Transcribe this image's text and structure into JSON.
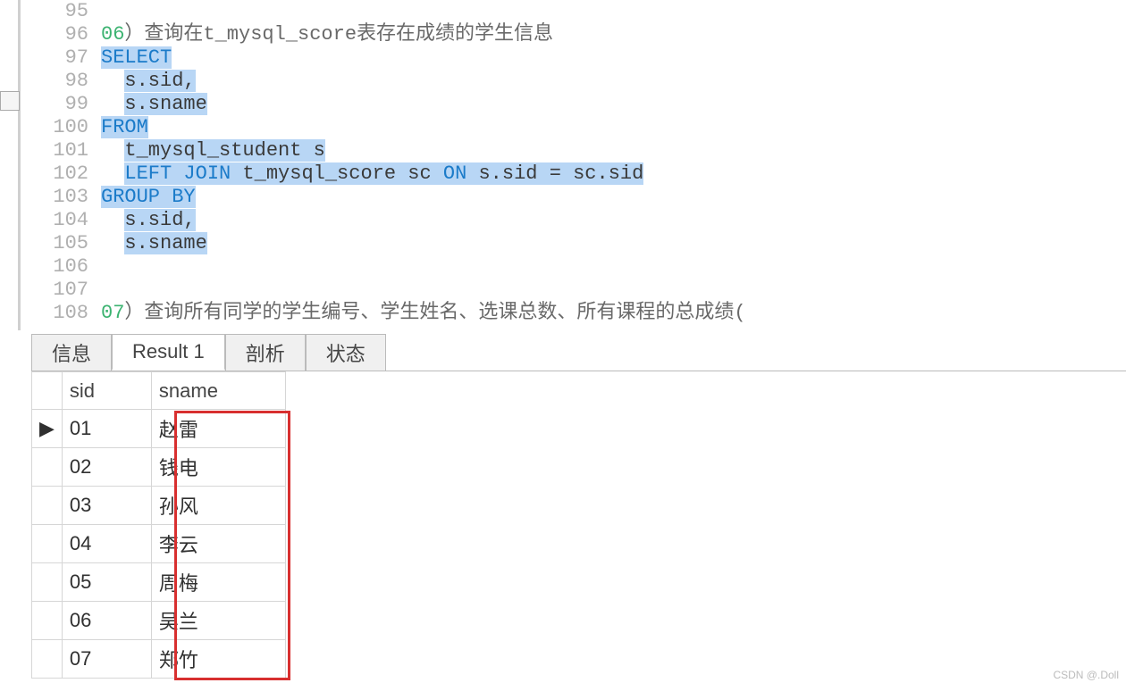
{
  "editor": {
    "line_numbers": [
      "95",
      "96",
      "97",
      "98",
      "99",
      "100",
      "101",
      "102",
      "103",
      "104",
      "105",
      "106",
      "107",
      "108"
    ],
    "lines": {
      "l95": "",
      "l96_pre": "06）查询在t_mysql_score表存在成绩的学生信息",
      "l97_kw": "SELECT",
      "l98_txt": "s.sid,",
      "l99_txt": "s.sname",
      "l100_kw": "FROM",
      "l101_txt": "t_mysql_student s",
      "l102_kw1": "LEFT JOIN",
      "l102_mid": " t_mysql_score sc ",
      "l102_kw2": "ON",
      "l102_tail": " s.sid = sc.sid",
      "l103_kw": "GROUP BY",
      "l104_txt": "s.sid,",
      "l105_txt": "s.sname",
      "l106": "",
      "l107": "",
      "l108_pre": "07）查询所有同学的学生编号、学生姓名、选课总数、所有课程的总成绩("
    }
  },
  "tabs": {
    "info": "信息",
    "result": "Result 1",
    "profile": "剖析",
    "status": "状态"
  },
  "result": {
    "columns": {
      "sid": "sid",
      "sname": "sname"
    },
    "rows": [
      {
        "sid": "01",
        "sname": "赵雷"
      },
      {
        "sid": "02",
        "sname": "钱电"
      },
      {
        "sid": "03",
        "sname": "孙风"
      },
      {
        "sid": "04",
        "sname": "李云"
      },
      {
        "sid": "05",
        "sname": "周梅"
      },
      {
        "sid": "06",
        "sname": "吴兰"
      },
      {
        "sid": "07",
        "sname": "郑竹"
      }
    ]
  },
  "watermark": "CSDN @.Doll"
}
